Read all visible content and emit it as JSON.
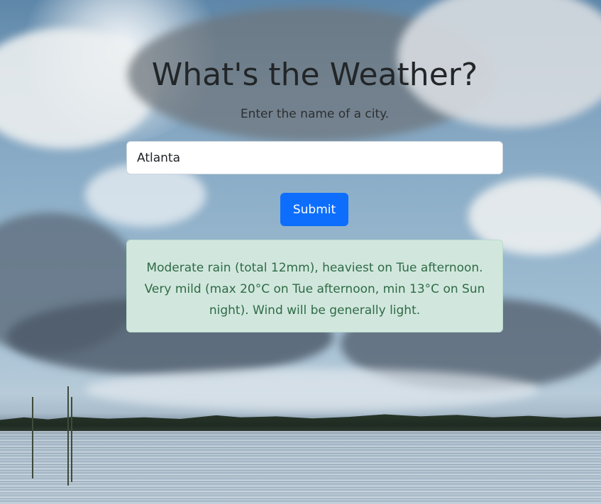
{
  "header": {
    "title": "What's the Weather?",
    "subtitle": "Enter the name of a city."
  },
  "search": {
    "value": "Atlanta",
    "placeholder": ""
  },
  "form": {
    "submit_label": "Submit"
  },
  "result": {
    "text": "Moderate rain (total 12mm), heaviest on Tue afternoon. Very mild (max 20°C on Tue afternoon, min 13°C on Sun night). Wind will be generally light."
  },
  "colors": {
    "button": "#0d6efd",
    "alert_bg": "#d1e7dd",
    "alert_text": "#2f6a46",
    "title_text": "#222628"
  }
}
